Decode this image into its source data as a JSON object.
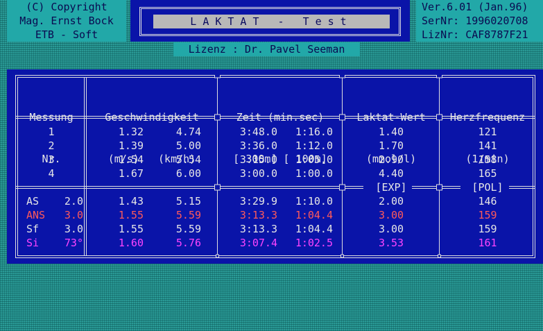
{
  "copyright": [
    "(C) Copyright",
    "Mag. Ernst Bock",
    "ETB - Soft"
  ],
  "version": [
    "Ver.6.01 (Jan.96)",
    "SerNr: 1996020708",
    "LizNr: CAF8787F21"
  ],
  "title": "LAKTAT - Test",
  "license": "Lizenz : Dr. Pavel Seeman",
  "headers": {
    "messung": [
      "Messung",
      "Nr."
    ],
    "geschw": [
      "Geschwindigkeit",
      "(m/s)   (km/h)"
    ],
    "zeit": [
      "Zeit (min.sec)",
      "[ 300m] [ 100m]"
    ],
    "laktat": [
      "Laktat-Wert",
      "(mmol/l)"
    ],
    "herz": [
      "Herzfrequenz",
      "(1/min)"
    ]
  },
  "rows": [
    {
      "nr": "1",
      "ms": "1.32",
      "kmh": "4.74",
      "t300": "3:48.0",
      "t100": "1:16.0",
      "lak": "1.40",
      "hf": "121"
    },
    {
      "nr": "2",
      "ms": "1.39",
      "kmh": "5.00",
      "t300": "3:36.0",
      "t100": "1:12.0",
      "lak": "1.70",
      "hf": "141"
    },
    {
      "nr": "3",
      "ms": "1.54",
      "kmh": "5.54",
      "t300": "3:15.0",
      "t100": "1:05.0",
      "lak": "2.90",
      "hf": "158"
    },
    {
      "nr": "4",
      "ms": "1.67",
      "kmh": "6.00",
      "t300": "3:00.0",
      "t100": "1:00.0",
      "lak": "4.40",
      "hf": "165"
    }
  ],
  "separator_labels": {
    "laktat": "[EXP]",
    "herz": "[POL]"
  },
  "results": [
    {
      "label": "AS",
      "val": "2.0",
      "ms": "1.43",
      "kmh": "5.15",
      "t300": "3:29.9",
      "t100": "1:10.0",
      "lak": "2.00",
      "hf": "146",
      "color": "#e6e6e6"
    },
    {
      "label": "ANS",
      "val": "3.0",
      "ms": "1.55",
      "kmh": "5.59",
      "t300": "3:13.3",
      "t100": "1:04.4",
      "lak": "3.00",
      "hf": "159",
      "color": "#ff5a5a"
    },
    {
      "label": "Sf",
      "val": "3.0",
      "ms": "1.55",
      "kmh": "5.59",
      "t300": "3:13.3",
      "t100": "1:04.4",
      "lak": "3.00",
      "hf": "159",
      "color": "#e6e6e6"
    },
    {
      "label": "Si",
      "val": "73°",
      "ms": "1.60",
      "kmh": "5.76",
      "t300": "3:07.4",
      "t100": "1:02.5",
      "lak": "3.53",
      "hf": "161",
      "color": "#ff44ff"
    }
  ]
}
